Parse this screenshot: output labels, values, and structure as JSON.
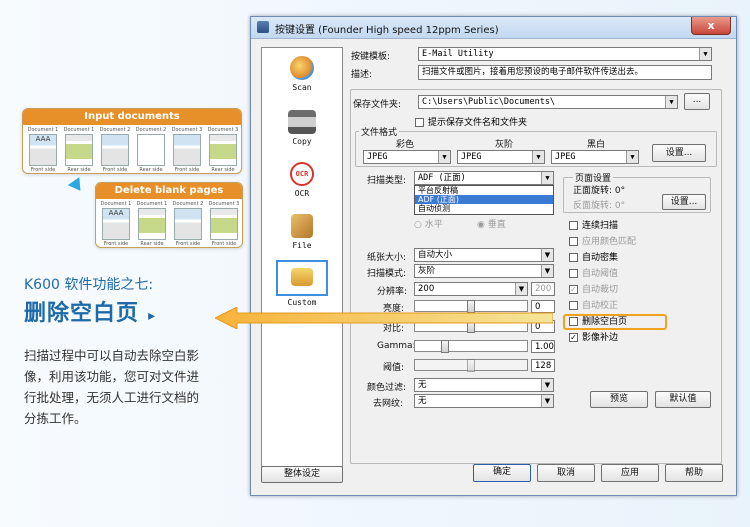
{
  "illustration": {
    "input_title": "Input documents",
    "delete_title": "Delete blank pages",
    "input_docs": [
      {
        "label": "Document 1",
        "side": "Front side"
      },
      {
        "label": "Document 1",
        "side": "Rear side"
      },
      {
        "label": "Document 2",
        "side": "Front side"
      },
      {
        "label": "Document 2",
        "side": "Rear side"
      },
      {
        "label": "Document 3",
        "side": "Front side"
      },
      {
        "label": "Document 3",
        "side": "Rear side"
      }
    ],
    "output_docs": [
      {
        "label": "Document 1",
        "side": "Front side"
      },
      {
        "label": "Document 1",
        "side": "Rear side"
      },
      {
        "label": "Document 2",
        "side": "Front side"
      },
      {
        "label": "Document 3",
        "side": "Front side"
      }
    ],
    "sample_text": "AAA"
  },
  "promo": {
    "subtitle": "K600 软件功能之七:",
    "title": "删除空白页",
    "title_arrow": "▸",
    "desc_lines": [
      "扫描过程中可以自动去除空白影",
      "像，利用该功能，您可对文件进",
      "行批处理，无须人工进行文档的",
      "分拣工作。"
    ]
  },
  "window": {
    "title": "按键设置 (Founder High speed 12ppm Series)",
    "close": "x",
    "sidebar": [
      {
        "label": "Scan",
        "icon": "scan-icon"
      },
      {
        "label": "Copy",
        "icon": "printer-icon"
      },
      {
        "label": "OCR",
        "icon": "ocr-icon",
        "badge": "OCR"
      },
      {
        "label": "File",
        "icon": "file-icon"
      },
      {
        "label": "Custom",
        "icon": "custom-icon"
      }
    ],
    "global_settings": "整体设定",
    "template_label": "按键模板:",
    "template_value": "E-Mail Utility",
    "desc_label": "描述:",
    "desc_value": "扫描文件或图片，接着用您预设的电子邮件软件传送出去。",
    "folder_label": "保存文件夹:",
    "folder_value": "C:\\Users\\Public\\Documents\\",
    "browse": "...",
    "prompt_save": "提示保存文件名和文件夹",
    "format_group": "文件格式",
    "color_label": "彩色",
    "gray_label": "灰阶",
    "bw_label": "黑白",
    "color_fmt": "JPEG",
    "gray_fmt": "JPEG",
    "bw_fmt": "JPEG",
    "format_settings": "设置...",
    "scan_type_label": "扫描类型:",
    "scan_type_value": "ADF (正面)",
    "scan_type_options": [
      "平台反射稿",
      "ADF (正面)",
      "自动侦测"
    ],
    "orientation_h": "水平",
    "orientation_v": "垂直",
    "page_group": "页面设置",
    "front_rotate": "正面旋转: 0°",
    "back_rotate": "反面旋转: 0°",
    "page_settings": "设置...",
    "paper_label": "纸张大小:",
    "paper_value": "自动大小",
    "mode_label": "扫描模式:",
    "mode_value": "灰阶",
    "dpi_label": "分辨率:",
    "dpi_value": "200",
    "dpi_alt": "200",
    "brightness_label": "亮度:",
    "brightness_value": "0",
    "contrast_label": "对比:",
    "contrast_value": "0",
    "gamma_label": "Gamma:",
    "gamma_value": "1.00",
    "threshold_label": "阈值:",
    "threshold_value": "128",
    "colorfilter_label": "颜色过滤:",
    "colorfilter_value": "无",
    "descreen_label": "去网纹:",
    "descreen_value": "无",
    "options": [
      {
        "label": "连续扫描",
        "checked": false,
        "disabled": false
      },
      {
        "label": "应用颜色匹配",
        "checked": false,
        "disabled": true
      },
      {
        "label": "自动密集",
        "checked": false,
        "disabled": false
      },
      {
        "label": "自动阈值",
        "checked": false,
        "disabled": true
      },
      {
        "label": "自动裁切",
        "checked": true,
        "disabled": true
      },
      {
        "label": "自动校正",
        "checked": false,
        "disabled": true
      },
      {
        "label": "删除空白页",
        "checked": false,
        "disabled": false
      },
      {
        "label": "影像补边",
        "checked": true,
        "disabled": false
      }
    ],
    "preview": "预览",
    "default": "默认值",
    "ok": "确定",
    "cancel": "取消",
    "apply": "应用",
    "help": "帮助"
  },
  "colors": {
    "accent_blue": "#1e6aa8",
    "orange": "#e7902a",
    "highlight": "#f2a31d"
  }
}
